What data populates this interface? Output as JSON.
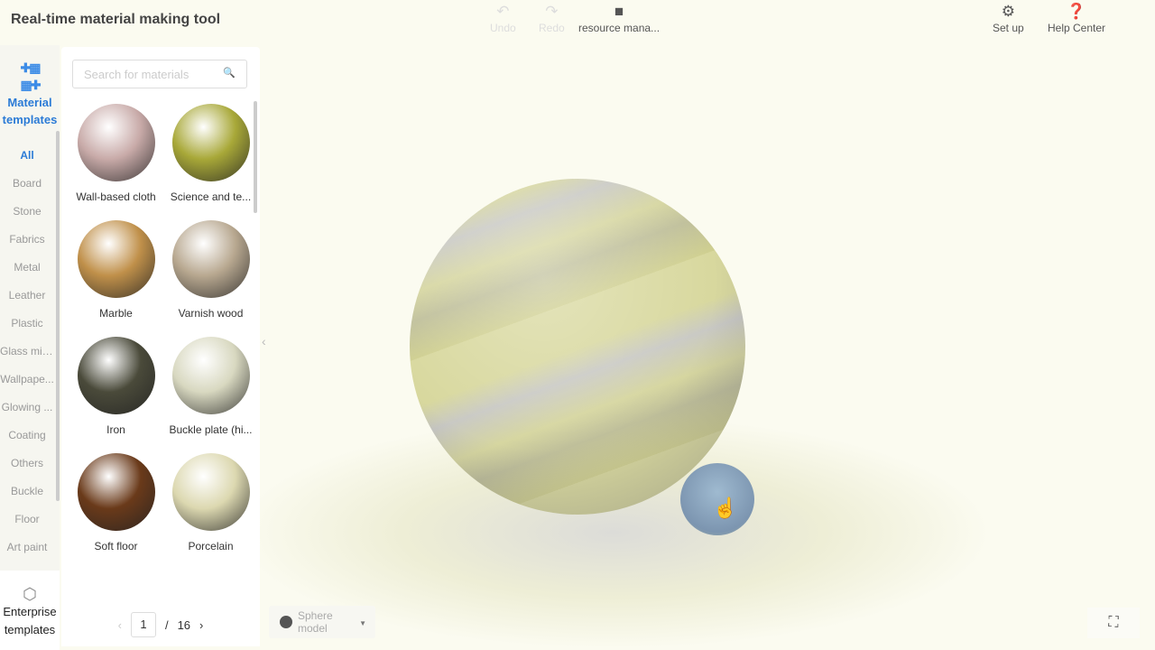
{
  "app": {
    "title": "Real-time material making tool"
  },
  "toolbar": {
    "undo": "Undo",
    "redo": "Redo",
    "resource": "resource mana...",
    "setup": "Set up",
    "help": "Help Center"
  },
  "sidebar": {
    "templates_label": "Material templates",
    "enterprise_label": "Enterprise templates",
    "categories": [
      "All",
      "Board",
      "Stone",
      "Fabrics",
      "Metal",
      "Leather",
      "Plastic",
      "Glass mirr...",
      "Wallpape...",
      "Glowing ...",
      "Coating",
      "Others",
      "Buckle",
      "Floor",
      "Art paint"
    ]
  },
  "panel": {
    "search_placeholder": "Search for materials",
    "materials": [
      {
        "name": "Wall-based cloth",
        "color": "#c8aaa8"
      },
      {
        "name": "Science and te...",
        "color": "#a8a838"
      },
      {
        "name": "Marble",
        "color": "#c0904a"
      },
      {
        "name": "Varnish wood",
        "color": "#b8a890"
      },
      {
        "name": "Iron",
        "color": "#4a4a3a"
      },
      {
        "name": "Buckle plate (hi...",
        "color": "#d8d8c0"
      },
      {
        "name": "Soft floor",
        "color": "#6a3a1a"
      },
      {
        "name": "Porcelain",
        "color": "#dcd8b0"
      }
    ],
    "pagination": {
      "current": "1",
      "separator": "/",
      "total": "16"
    }
  },
  "viewport": {
    "model_label": "Sphere model"
  }
}
